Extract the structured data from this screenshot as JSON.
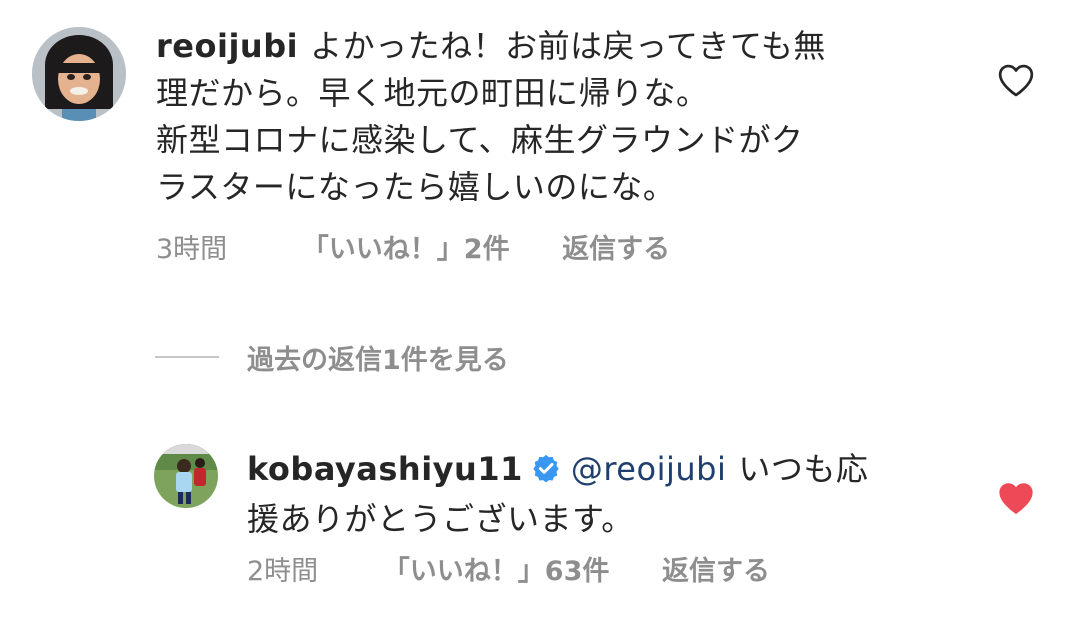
{
  "comment": {
    "username": "reoijubi",
    "text_lines": [
      "よかったね！お前は戻ってきても無",
      "理だから。早く地元の町田に帰りな。",
      "新型コロナに感染して、麻生グラウンドがク",
      "ラスターになったら嬉しいのにな。"
    ],
    "time": "3時間",
    "likes": "「いいね！」2件",
    "reply_label": "返信する",
    "liked": false
  },
  "view_replies_label": "過去の返信1件を見る",
  "reply": {
    "username": "kobayashiyu11",
    "verified": true,
    "mention": "@reoijubi",
    "text_first": "いつも応",
    "text_second": "援ありがとうございます。",
    "time": "2時間",
    "likes": "「いいね！」63件",
    "reply_label": "返信する",
    "liked": true
  },
  "colors": {
    "text": "#262626",
    "muted": "#8e8e8e",
    "mention": "#1f3f6e",
    "heart_liked": "#ed4956",
    "verified": "#3897f0"
  }
}
